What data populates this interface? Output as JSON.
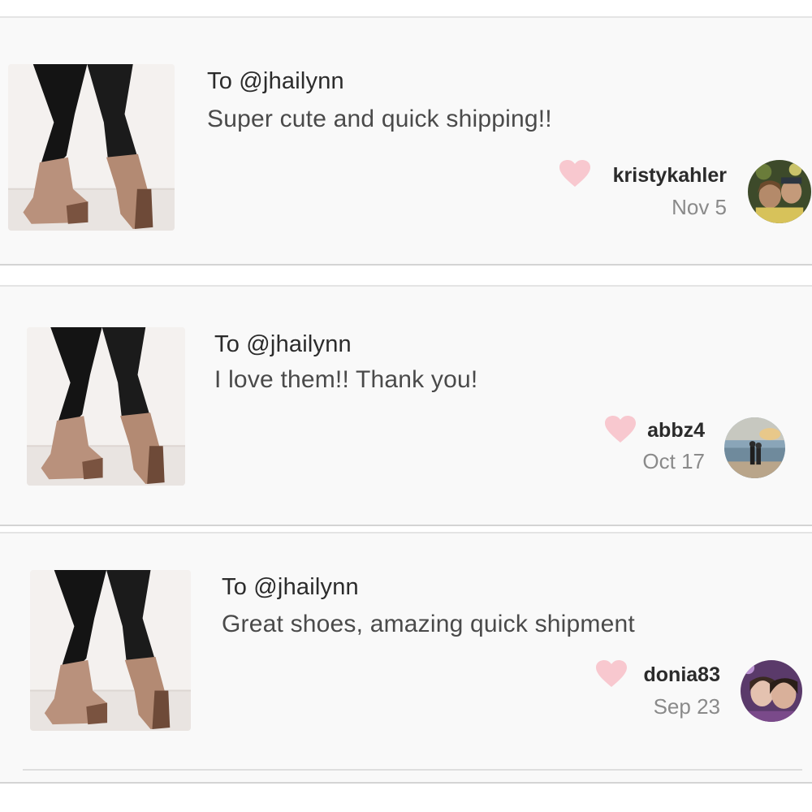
{
  "colors": {
    "card_bg": "#f9f9f9",
    "heart": "#f8c8cf",
    "username": "#2b2b2b",
    "date": "#8a8a8a"
  },
  "reviews": [
    {
      "to": "To @jhailynn",
      "message": "Super cute and quick shipping!!",
      "username": "kristykahler",
      "date": "Nov 5",
      "heart_icon": "heart-icon",
      "thumbnail": "wedge-bootie-photo",
      "avatar": "user-avatar-photo"
    },
    {
      "to": "To @jhailynn",
      "message": "I love them!! Thank you!",
      "username": "abbz4",
      "date": "Oct 17",
      "heart_icon": "heart-icon",
      "thumbnail": "wedge-bootie-photo",
      "avatar": "user-avatar-photo"
    },
    {
      "to": "To @jhailynn",
      "message": "Great shoes, amazing quick shipment",
      "username": "donia83",
      "date": "Sep 23",
      "heart_icon": "heart-icon",
      "thumbnail": "wedge-bootie-photo",
      "avatar": "user-avatar-photo"
    }
  ]
}
